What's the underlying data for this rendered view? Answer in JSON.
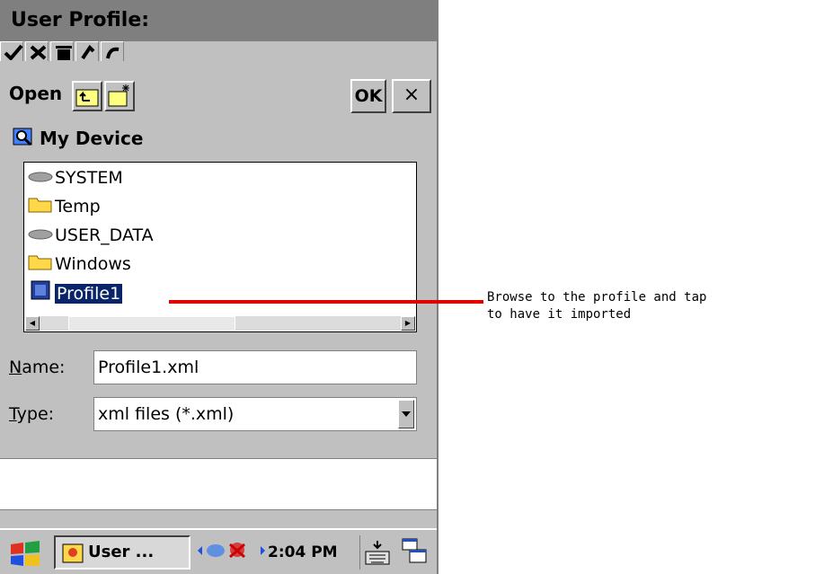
{
  "window": {
    "title": "User Profile:"
  },
  "toolbar": {
    "icons": [
      "checkmark-icon",
      "x-icon",
      "trash-icon",
      "undo-icon",
      "redo-icon"
    ]
  },
  "dialog": {
    "open_label": "Open",
    "ok_label": "OK",
    "close_label": "×",
    "location": "My Device",
    "files": [
      {
        "label": "SYSTEM",
        "icon": "drive-icon"
      },
      {
        "label": "Temp",
        "icon": "folder-icon"
      },
      {
        "label": "USER_DATA",
        "icon": "drive-icon"
      },
      {
        "label": "Windows",
        "icon": "folder-icon"
      },
      {
        "label": "Profile1",
        "icon": "xml-file-icon",
        "selected": true
      }
    ],
    "name_label_u": "N",
    "name_label_rest": "ame:",
    "name_value": "Profile1.xml",
    "type_label_u": "T",
    "type_label_rest": "ype:",
    "type_value": "xml files (*.xml)"
  },
  "taskbar": {
    "task_label": "User ...",
    "clock": "2:04 PM"
  },
  "annotation": {
    "line1": "Browse to the profile and tap",
    "line2": "to have it imported",
    "color": "#e00000"
  }
}
